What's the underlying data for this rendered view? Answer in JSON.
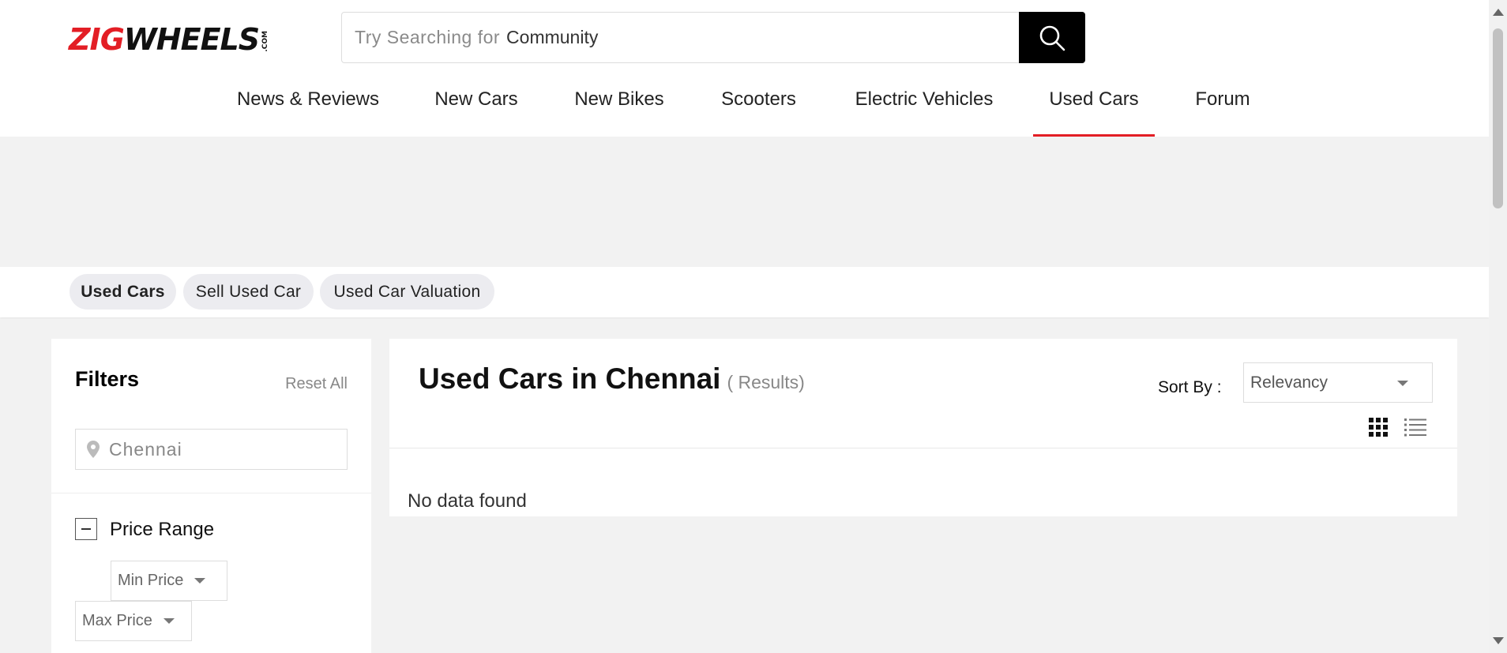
{
  "header": {
    "logo": {
      "part1": "ZIG",
      "part2": "WHEELS",
      "suffix": ".COM"
    },
    "search": {
      "prefix": "Try Searching for",
      "term": "Community",
      "icon": "search-icon"
    },
    "nav": [
      {
        "label": "News & Reviews"
      },
      {
        "label": "New Cars"
      },
      {
        "label": "New Bikes"
      },
      {
        "label": "Scooters"
      },
      {
        "label": "Electric Vehicles"
      },
      {
        "label": "Used Cars",
        "active": true
      },
      {
        "label": "Forum"
      }
    ],
    "accent_color": "#e31e25"
  },
  "subtabs": [
    {
      "label": "Used Cars",
      "active": true
    },
    {
      "label": "Sell Used Car"
    },
    {
      "label": "Used Car Valuation"
    }
  ],
  "filters": {
    "title": "Filters",
    "reset_label": "Reset All",
    "city": {
      "value": "Chennai",
      "icon": "location-pin-icon"
    },
    "price_range": {
      "label": "Price Range",
      "min_label": "Min Price",
      "max_label": "Max Price"
    }
  },
  "results": {
    "title": "Used Cars in Chennai",
    "count_text": "( Results)",
    "sort_label": "Sort By :",
    "sort_value": "Relevancy",
    "empty_text": "No data found"
  }
}
